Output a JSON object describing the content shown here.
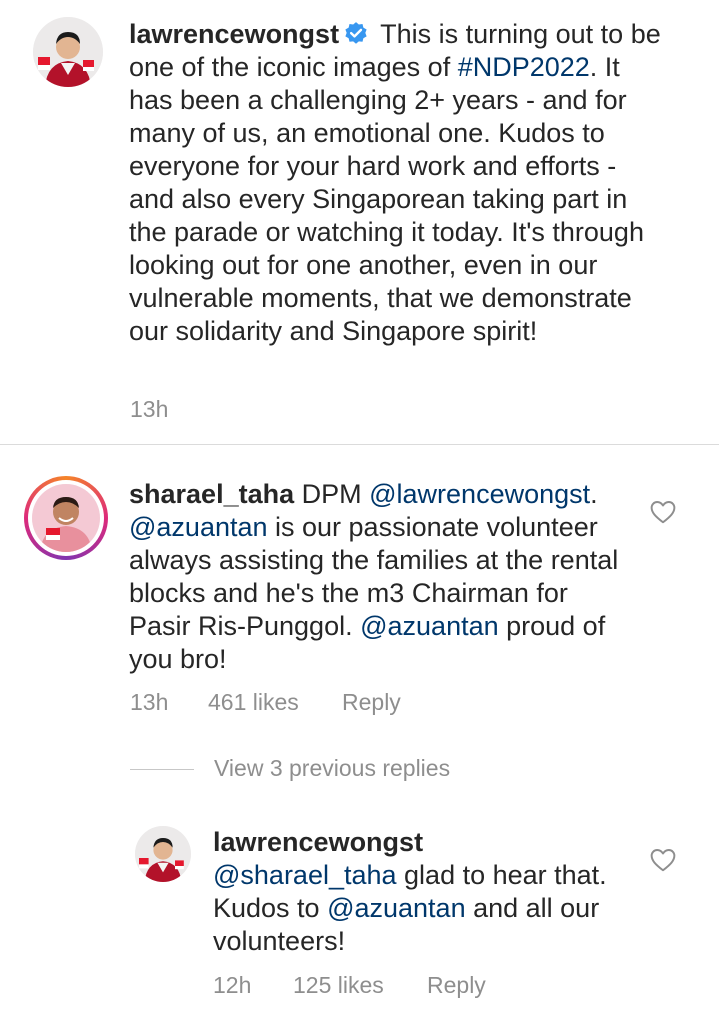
{
  "comments": [
    {
      "username": "lawrencewongst",
      "verified": true,
      "segments": [
        {
          "text": " This is turning out to be one of the iconic images of ",
          "type": "text"
        },
        {
          "text": "#NDP2022",
          "type": "hashtag"
        },
        {
          "text": ". It has been a challenging 2+ years - and for many of us, an emotional one. Kudos to everyone for your hard work and efforts - and also every Singaporean taking part in the parade or watching it today. It's through looking out for one another, even in our vulnerable moments, that we demonstrate our solidarity and Singapore spirit!",
          "type": "text"
        }
      ],
      "time": "13h"
    },
    {
      "username": "sharael_taha",
      "segments": [
        {
          "text": " DPM ",
          "type": "text"
        },
        {
          "text": "@lawrencewongst",
          "type": "mention"
        },
        {
          "text": ". ",
          "type": "text"
        },
        {
          "text": "@azuantan",
          "type": "mention"
        },
        {
          "text": " is our passionate volunteer always assisting the families at the rental blocks and he's the m3 Chairman for Pasir Ris-Punggol. ",
          "type": "text"
        },
        {
          "text": "@azuantan",
          "type": "mention"
        },
        {
          "text": " proud of you bro!",
          "type": "text"
        }
      ],
      "time": "13h",
      "likes": "461 likes",
      "reply_label": "Reply"
    },
    {
      "username": "lawrencewongst",
      "segments": [
        {
          "text": "@sharael_taha",
          "type": "mention"
        },
        {
          "text": " glad to hear that. Kudos to ",
          "type": "text"
        },
        {
          "text": "@azuantan",
          "type": "mention"
        },
        {
          "text": " and all our volunteers!",
          "type": "text"
        }
      ],
      "time": "12h",
      "likes": "125 likes",
      "reply_label": "Reply"
    }
  ],
  "view_replies": "View 3 previous replies",
  "colors": {
    "text": "#262626",
    "mention": "#00376b",
    "meta": "#8e8e8e",
    "verified": "#3897f0"
  },
  "icons": [
    "verified-badge-icon",
    "heart-icon"
  ]
}
